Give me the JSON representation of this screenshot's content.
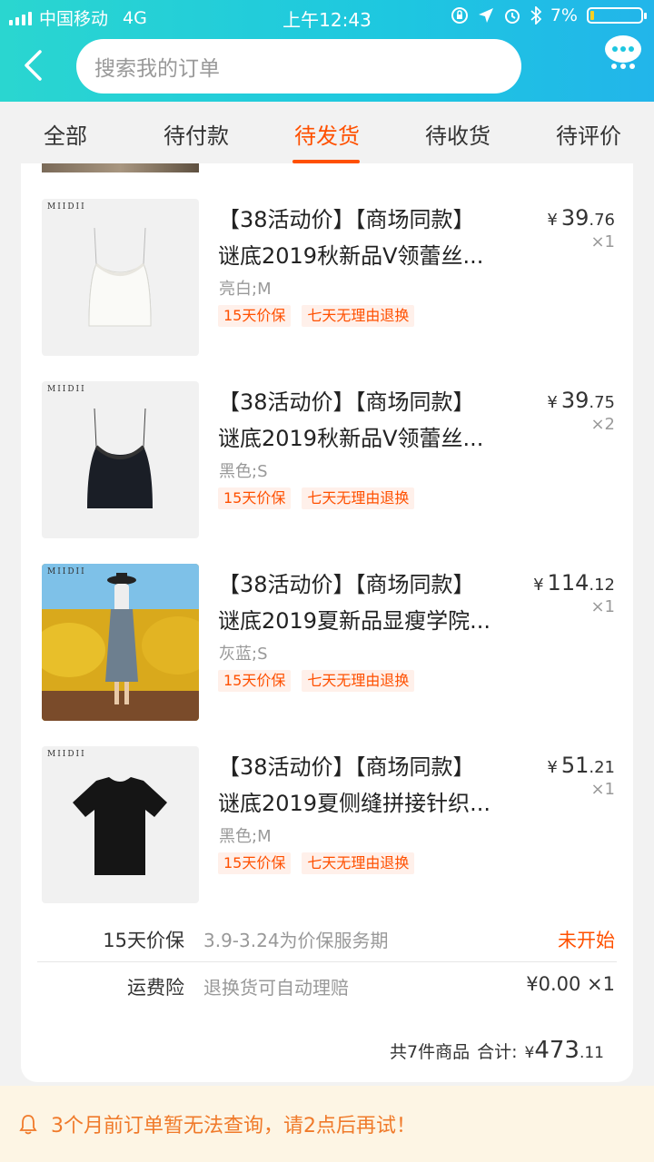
{
  "status": {
    "carrier": "中国移动",
    "network": "4G",
    "time": "上午12:43",
    "battery": "7%"
  },
  "search": {
    "placeholder": "搜索我的订单"
  },
  "tabs": [
    "全部",
    "待付款",
    "待发货",
    "待收货",
    "待评价"
  ],
  "active_tab": 2,
  "items": [
    {
      "brand": "MIIDII",
      "title_line1": "【38活动价】【商场同款】",
      "title_line2": "谜底2019秋新品V领蕾丝...",
      "spec": "亮白;M",
      "price_yen": "¥",
      "price_int": "39",
      "price_dec": ".76",
      "qty": "×1",
      "tags": [
        "15天价保",
        "七天无理由退换"
      ]
    },
    {
      "brand": "MIIDII",
      "title_line1": "【38活动价】【商场同款】",
      "title_line2": "谜底2019秋新品V领蕾丝...",
      "spec": "黑色;S",
      "price_yen": "¥",
      "price_int": "39",
      "price_dec": ".75",
      "qty": "×2",
      "tags": [
        "15天价保",
        "七天无理由退换"
      ]
    },
    {
      "brand": "MIIDII",
      "title_line1": "【38活动价】【商场同款】",
      "title_line2": "谜底2019夏新品显瘦学院...",
      "spec": "灰蓝;S",
      "price_yen": "¥",
      "price_int": "114",
      "price_dec": ".12",
      "qty": "×1",
      "tags": [
        "15天价保",
        "七天无理由退换"
      ]
    },
    {
      "brand": "MIIDII",
      "title_line1": "【38活动价】【商场同款】",
      "title_line2": "谜底2019夏侧缝拼接针织...",
      "spec": "黑色;M",
      "price_yen": "¥",
      "price_int": "51",
      "price_dec": ".21",
      "qty": "×1",
      "tags": [
        "15天价保",
        "七天无理由退换"
      ]
    }
  ],
  "services": [
    {
      "label": "15天价保",
      "desc": "3.9-3.24为价保服务期",
      "right": "未开始"
    },
    {
      "label": "运费险",
      "desc": "退换货可自动理赔",
      "right": "¥0.00 ×1"
    }
  ],
  "summary": {
    "count_text": "共7件商品",
    "total_label": "合计:",
    "yen": "¥",
    "total_int": "473",
    "total_dec": ".11"
  },
  "notice": {
    "text": "3个月前订单暂无法查询，请2点后再试！"
  },
  "colors": {
    "accent": "#ff5000",
    "header": "#1ec7e0",
    "notice_bg": "#fdf5e4",
    "notice_text": "#f07a2a"
  }
}
